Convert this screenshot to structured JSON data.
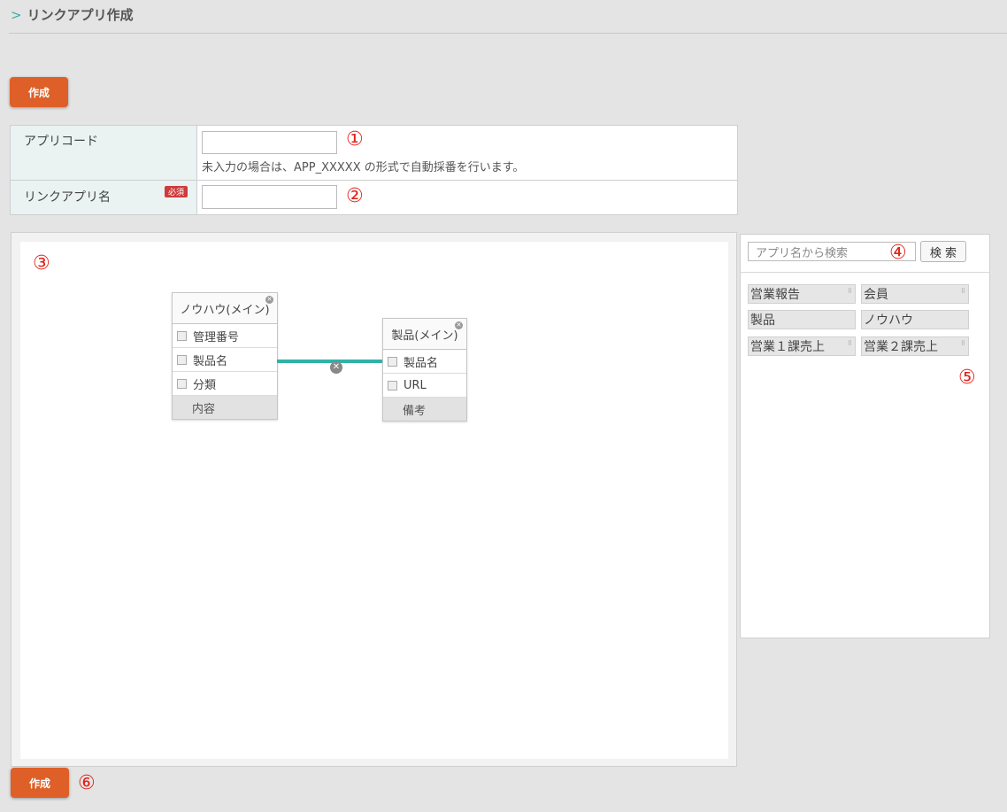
{
  "header": {
    "title": "リンクアプリ作成"
  },
  "top_button": {
    "label": "作成"
  },
  "bottom_button": {
    "label": "作成"
  },
  "form": {
    "app_code": {
      "label": "アプリコード",
      "value": "",
      "hint": "未入力の場合は、APP_XXXXX の形式で自動採番を行います。"
    },
    "link_app_name": {
      "label": "リンクアプリ名",
      "required_badge": "必須",
      "value": ""
    }
  },
  "canvas": {
    "apps": [
      {
        "title": "ノウハウ(メイン)",
        "fields": [
          "管理番号",
          "製品名",
          "分類"
        ],
        "plain_fields": [
          "内容"
        ]
      },
      {
        "title": "製品(メイン)",
        "fields": [
          "製品名",
          "URL"
        ],
        "plain_fields": [
          "備考"
        ]
      }
    ]
  },
  "side": {
    "search_placeholder": "アプリ名から検索",
    "search_button": "検 索",
    "apps": [
      "営業報告",
      "会員",
      "製品",
      "ノウハウ",
      "営業１課売上",
      "営業２課売上"
    ]
  },
  "markers": [
    "①",
    "②",
    "③",
    "④",
    "⑤",
    "⑥"
  ],
  "colors": {
    "accent_button": "#de5f27",
    "link_line": "#2fb2a6",
    "marker": "#e2231a"
  }
}
